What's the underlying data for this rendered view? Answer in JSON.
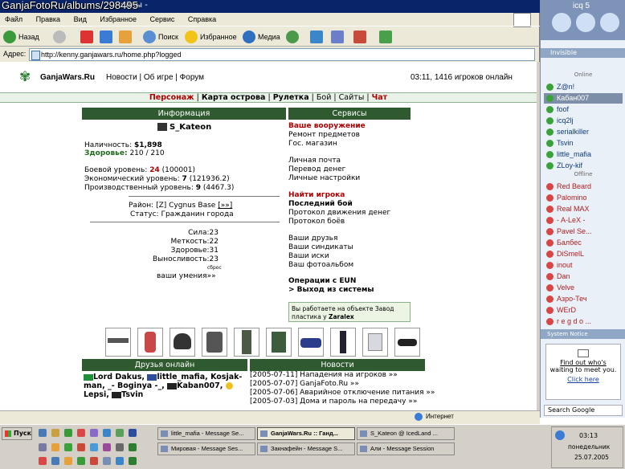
{
  "watermark": "GanjaFotoRu/albums/298495",
  "browser": {
    "title_fragment": "ойны -",
    "menu": [
      "Файл",
      "Правка",
      "Вид",
      "Избранное",
      "Сервис",
      "Справка"
    ],
    "toolbar": {
      "back": "Назад",
      "search": "Поиск",
      "favorites": "Избранное",
      "media": "Медиа"
    },
    "address_label": "Адрес:",
    "address": "http://kenny.ganjawars.ru/home.php?logged",
    "status_text": "Интернет"
  },
  "site": {
    "title": "GanjaWars.Ru",
    "nav": "Новости | Об игре | Форум",
    "status": "03:11, 1416 игроков онлайн",
    "mainnav": [
      "Персонаж",
      "Карта острова",
      "Рулетка",
      "Бой",
      "Сайты",
      "Чат"
    ]
  },
  "info": {
    "header": "Информация",
    "player": "S_Kateon",
    "cash_label": "Наличность:",
    "cash_value": "$1,898",
    "health_label": "Здоровье:",
    "health_value": "210 / 210",
    "combat_label": "Боевой уровень:",
    "combat_level": "24",
    "combat_xp": "(100001)",
    "econ_label": "Экономический уровень:",
    "econ_level": "7",
    "econ_xp": "(121936.2)",
    "prod_label": "Производственный уровень:",
    "prod_level": "9",
    "prod_xp": "(4467.3)",
    "district_label": "Район:",
    "district_value": "[Z] Cygnus Base",
    "district_link": "[»»]",
    "status_label": "Статус:",
    "status_value": "Гражданин города",
    "stats": [
      {
        "label": "Сила:",
        "value": "23"
      },
      {
        "label": "Меткость:",
        "value": "22"
      },
      {
        "label": "Здоровье:",
        "value": "31"
      },
      {
        "label": "Выносливость:",
        "value": "23"
      }
    ],
    "reset": "сброс",
    "skills": "ваши умения»»"
  },
  "services": {
    "header": "Сервисы",
    "g1": [
      "Ваше вооружение",
      "Ремонт предметов",
      "Гос. магазин"
    ],
    "g2": [
      "Личная почта",
      "Перевод денег",
      "Личные настройки"
    ],
    "g3": [
      "Найти игрока",
      "Последний бой",
      "Протокол движения денег",
      "Протокол боёв"
    ],
    "g4": [
      "Ваши друзья",
      "Ваши синдикаты",
      "Ваши иски",
      "Ваш фотоальбом"
    ],
    "ops": "Операции с EUN",
    "exit": "> Выход из системы",
    "notice": "Вы работаете на объекте Завод пластика у",
    "notice_owner": "Zaralex"
  },
  "items_icons": [
    "rifle-icon",
    "armor-icon",
    "helmet-icon",
    "jacket-icon",
    "suit-icon",
    "boots-icon",
    "phone-icon",
    "car-icon",
    "phone2-icon",
    "pads-icon",
    "glasses-icon"
  ],
  "friends": {
    "header": "Друзья онлайн",
    "list": [
      "Lord Dakus",
      "little_mafia",
      "Kosjak-man",
      "_- Boginya -_",
      "Kaban007",
      "Lepsi",
      "Tsvin"
    ]
  },
  "news": {
    "header": "Новости",
    "items": [
      "[2005-07-11] Нападения на игроков »»",
      "[2005-07-07] GanjaFoto.Ru »»",
      "[2005-07-06] Аварийное отключение питания »»",
      "[2005-07-03] Дома и пароль на передачу »»"
    ]
  },
  "icq": {
    "title": "icq 5",
    "status": "Invisible",
    "online_label": "Online",
    "offline_label": "Offline",
    "online": [
      "Z@n!",
      "Кабан007",
      "foof",
      "icq2lj",
      "serialkiller",
      "Tsvin",
      "little_mafia",
      "ZLoy-kif"
    ],
    "offline": [
      "Red Beard",
      "Palomino",
      "Real MAX",
      "- A-LeX -",
      "Pavel Se...",
      "Балбес",
      "DiSmelL",
      "inout",
      "Dan",
      "Velve",
      "Азро-Теч",
      "WErD",
      "r e g d o ..."
    ],
    "notice_title": "System Notice",
    "ad_line1": "Find out who's",
    "ad_line2": "waiting to meet you.",
    "ad_link": "Click here",
    "search": "Search Google"
  },
  "taskbar": {
    "start": "Пуск",
    "tasks": [
      "little_mafia - Message Se...",
      "GanjaWars.Ru :: Ганд...",
      "S_Kateon @ IcedLand ...",
      "Мировая - Message Ses...",
      "Закнафейн - Message S...",
      "Али - Message Session"
    ],
    "time": "03:13",
    "day": "понедельник",
    "date": "25.07.2005"
  }
}
